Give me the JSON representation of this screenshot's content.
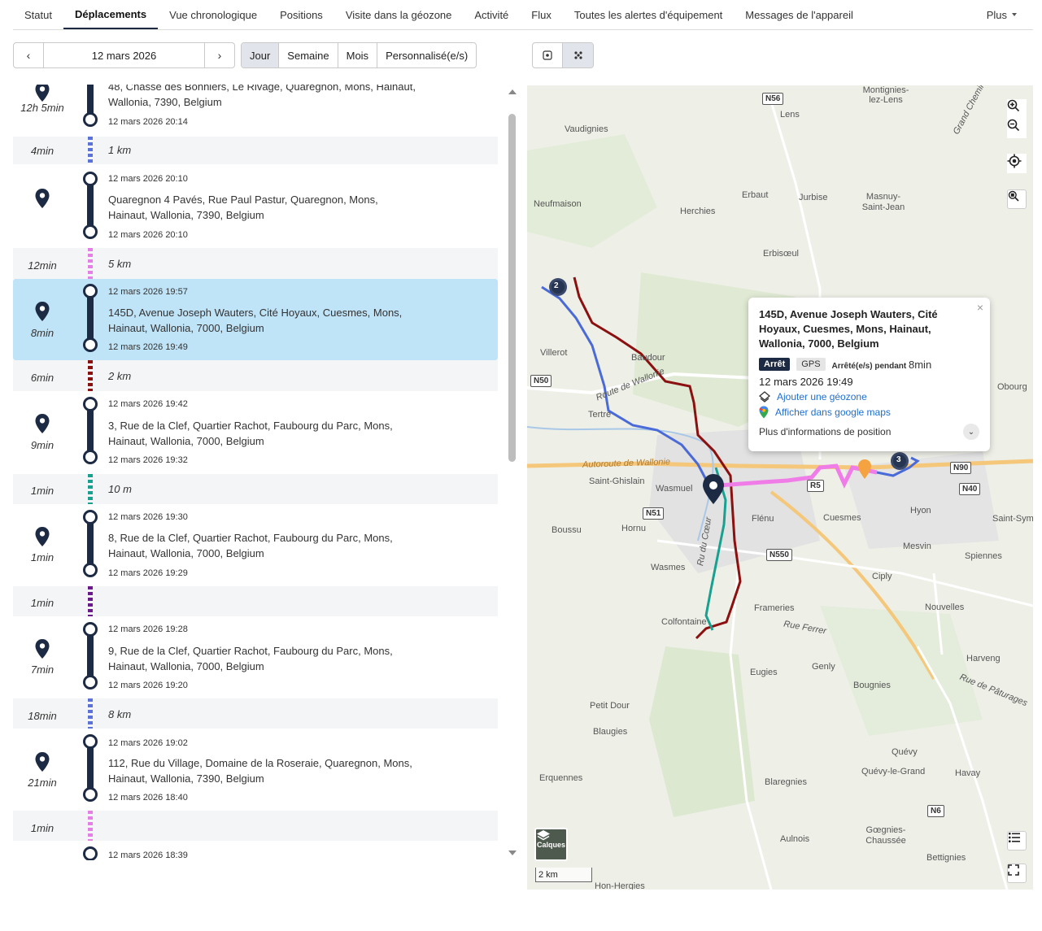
{
  "tabs": [
    {
      "label": "Statut"
    },
    {
      "label": "Déplacements"
    },
    {
      "label": "Vue chronologique"
    },
    {
      "label": "Positions"
    },
    {
      "label": "Visite dans la géozone"
    },
    {
      "label": "Activité"
    },
    {
      "label": "Flux"
    },
    {
      "label": "Toutes les alertes d'équipement"
    },
    {
      "label": "Messages de l'appareil"
    }
  ],
  "more_label": "Plus",
  "date_nav": {
    "date": "12 mars 2026",
    "prev": "‹",
    "next": "›"
  },
  "range": [
    "Jour",
    "Semaine",
    "Mois",
    "Personnalisé(e/s)"
  ],
  "timeline": {
    "stops": [
      {
        "duration": "12h 5min",
        "address": "48, Chasse des Bonniers, Le Rivage, Quaregnon, Mons, Hainaut, Wallonia, 7390, Belgium",
        "start": "",
        "end": "12 mars 2026 20:14"
      },
      {
        "duration": "",
        "address": "Quaregnon 4 Pavés, Rue Paul Pastur, Quaregnon, Mons, Hainaut, Wallonia, 7390, Belgium",
        "start": "12 mars 2026 20:10",
        "end": "12 mars 2026 20:10"
      },
      {
        "duration": "8min",
        "address": "145D, Avenue Joseph Wauters, Cité Hoyaux, Cuesmes, Mons, Hainaut, Wallonia, 7000, Belgium",
        "start": "12 mars 2026 19:57",
        "end": "12 mars 2026 19:49"
      },
      {
        "duration": "9min",
        "address": "3, Rue de la Clef, Quartier Rachot, Faubourg du Parc, Mons, Hainaut, Wallonia, 7000, Belgium",
        "start": "12 mars 2026 19:42",
        "end": "12 mars 2026 19:32"
      },
      {
        "duration": "1min",
        "address": "8, Rue de la Clef, Quartier Rachot, Faubourg du Parc, Mons, Hainaut, Wallonia, 7000, Belgium",
        "start": "12 mars 2026 19:30",
        "end": "12 mars 2026 19:29"
      },
      {
        "duration": "7min",
        "address": "9, Rue de la Clef, Quartier Rachot, Faubourg du Parc, Mons, Hainaut, Wallonia, 7000, Belgium",
        "start": "12 mars 2026 19:28",
        "end": "12 mars 2026 19:20"
      },
      {
        "duration": "21min",
        "address": "112, Rue du Village, Domaine de la Roseraie, Quaregnon, Mons, Hainaut, Wallonia, 7390, Belgium",
        "start": "12 mars 2026 19:02",
        "end": "12 mars 2026 18:40"
      },
      {
        "duration": "",
        "address": "",
        "start": "12 mars 2026 18:39",
        "end": ""
      }
    ],
    "trips": [
      {
        "duration": "4min",
        "distance": "1 km",
        "color": "#5b73d9"
      },
      {
        "duration": "12min",
        "distance": "5 km",
        "color": "#e57ee5"
      },
      {
        "duration": "6min",
        "distance": "2 km",
        "color": "#8b1010"
      },
      {
        "duration": "1min",
        "distance": "10 m",
        "color": "#18a090"
      },
      {
        "duration": "1min",
        "distance": "",
        "color": "#6a1a8a"
      },
      {
        "duration": "18min",
        "distance": "8 km",
        "color": "#5b73d9"
      },
      {
        "duration": "1min",
        "distance": "",
        "color": "#e57ee5"
      }
    ]
  },
  "map": {
    "labels": [
      {
        "text": "Vaudignies"
      },
      {
        "text": "Lens"
      },
      {
        "text": "Montignies-lez-Lens"
      },
      {
        "text": "Neufmaison"
      },
      {
        "text": "Herchies"
      },
      {
        "text": "Erbaut"
      },
      {
        "text": "Jurbise"
      },
      {
        "text": "Masnuy-Saint-Jean"
      },
      {
        "text": "Erbisœul"
      },
      {
        "text": "Villerot"
      },
      {
        "text": "Baudour"
      },
      {
        "text": "Tertre"
      },
      {
        "text": "Saint-Ghislain"
      },
      {
        "text": "Wasmuel"
      },
      {
        "text": "Boussu"
      },
      {
        "text": "Hornu"
      },
      {
        "text": "Flénu"
      },
      {
        "text": "Cuesmes"
      },
      {
        "text": "Hyon"
      },
      {
        "text": "Mesvin"
      },
      {
        "text": "Spiennes"
      },
      {
        "text": "Wasmes"
      },
      {
        "text": "Ciply"
      },
      {
        "text": "Frameries"
      },
      {
        "text": "Colfontaine"
      },
      {
        "text": "Nouvelles"
      },
      {
        "text": "Eugies"
      },
      {
        "text": "Genly"
      },
      {
        "text": "Harveng"
      },
      {
        "text": "Bougnies"
      },
      {
        "text": "Petit Dour"
      },
      {
        "text": "Blaugies"
      },
      {
        "text": "Quévy"
      },
      {
        "text": "Quévy-le-Grand"
      },
      {
        "text": "Havay"
      },
      {
        "text": "Erquennes"
      },
      {
        "text": "Blaregnies"
      },
      {
        "text": "Aulnois"
      },
      {
        "text": "Gœgnies-Chaussée"
      },
      {
        "text": "Bettignies"
      },
      {
        "text": "Hon-Hergies"
      },
      {
        "text": "Obourg"
      },
      {
        "text": "Saint-Symphorien"
      },
      {
        "text": "Autoroute de Wallonie"
      },
      {
        "text": "Route de Wallonie"
      },
      {
        "text": "Rue Ferrer"
      },
      {
        "text": "Rue de Pâturages"
      },
      {
        "text": "Ru du Cœur"
      },
      {
        "text": "Grand Chemin"
      }
    ],
    "roads": [
      "N56",
      "N50",
      "N51",
      "N550",
      "R5",
      "N90",
      "N40",
      "N6"
    ],
    "scale": "2 km",
    "layers_label": "Calques",
    "cluster_counts": [
      "2",
      "3"
    ]
  },
  "popup": {
    "title": "145D, Avenue Joseph Wauters, Cité Hoyaux, Cuesmes, Mons, Hainaut, Wallonia, 7000, Belgium",
    "badge_stop": "Arrêt",
    "badge_gps": "GPS",
    "stopped_for": "Arrêté(e/s) pendant",
    "stopped_value": "8min",
    "date": "12 mars 2026 19:49",
    "add_geozone": "Ajouter une géozone",
    "google_maps": "Afficher dans google maps",
    "more_info": "Plus d'informations de position"
  }
}
